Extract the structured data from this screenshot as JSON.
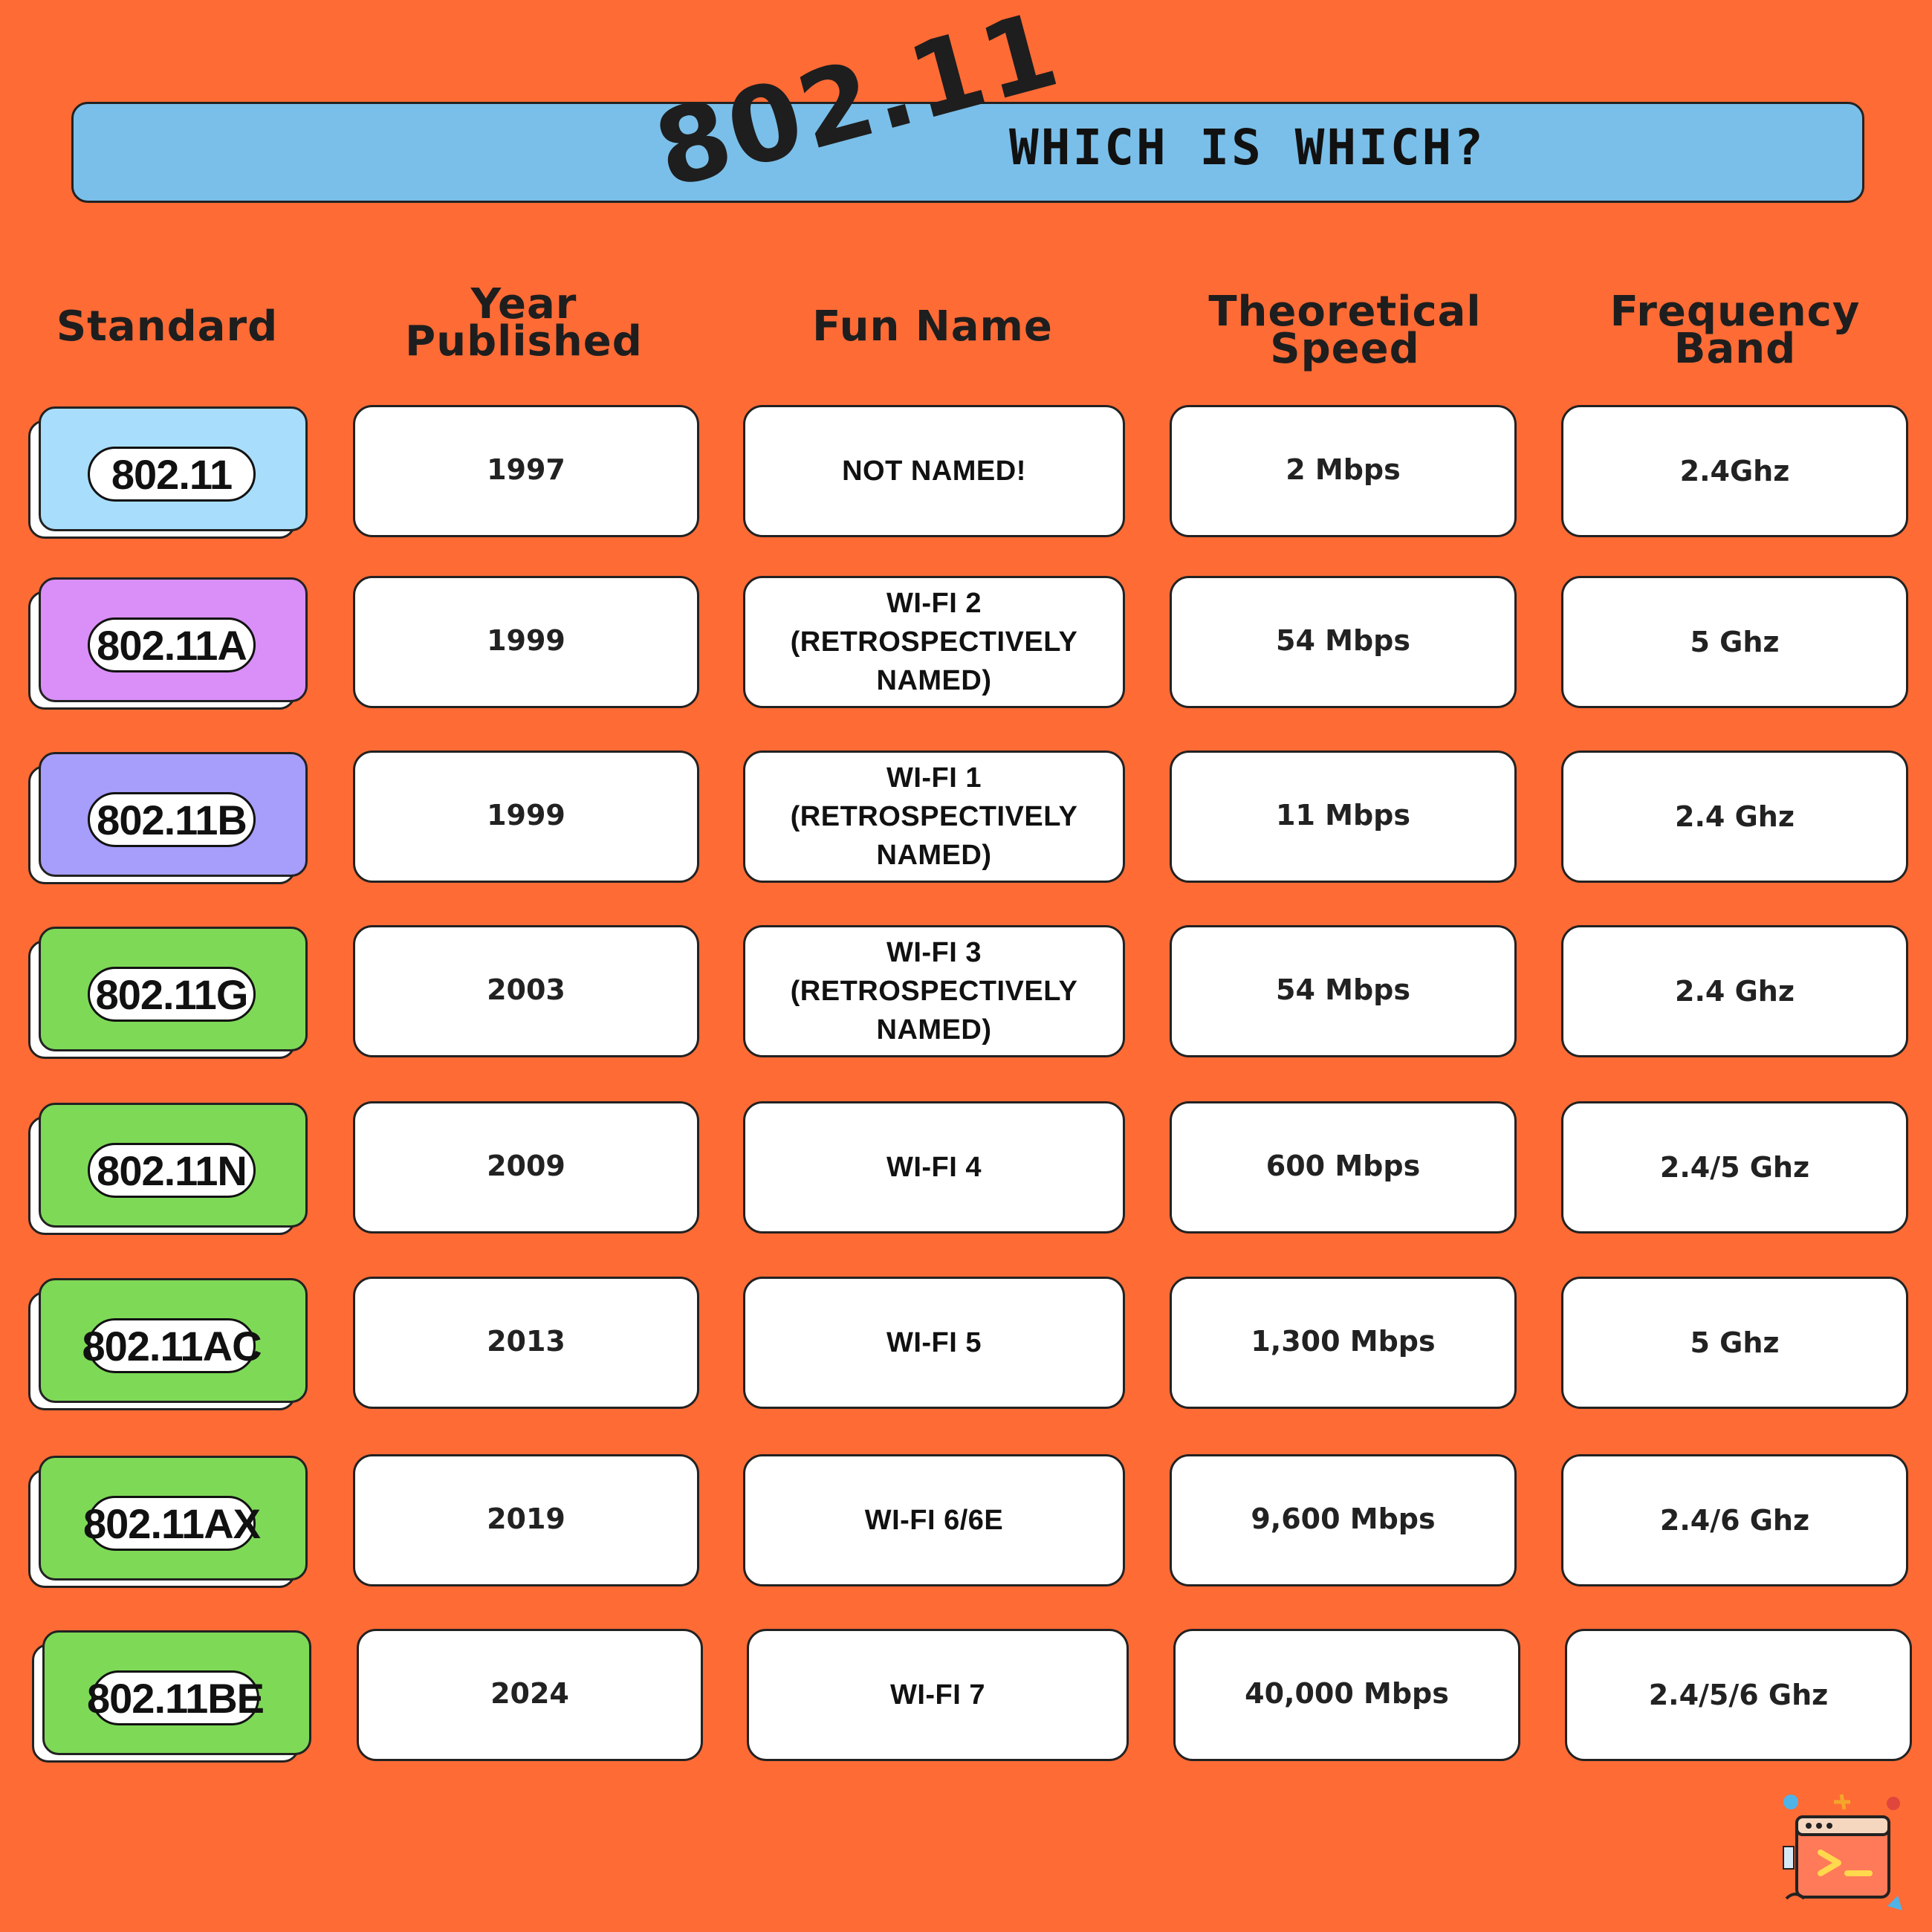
{
  "banner": {
    "big": "802.11",
    "title": "WHICH IS WHICH?"
  },
  "headers": {
    "standard": "Standard",
    "year": "Year\nPublished",
    "fun": "Fun Name",
    "speed": "Theoretical\nSpeed",
    "freq": "Frequency\nBand"
  },
  "colors": {
    "background": "#ff6b35",
    "banner": "#7abfe9",
    "light_blue": "#a8ddfb",
    "violet": "#d98ff7",
    "periwinkle": "#a79dfb",
    "green": "#7ed957"
  },
  "rows": [
    {
      "standard": "802.11",
      "year": "1997",
      "fun": "NOT NAMED!",
      "speed": "2 Mbps",
      "freq": "2.4Ghz",
      "color": "#a8ddfb"
    },
    {
      "standard": "802.11A",
      "year": "1999",
      "fun": "WI-FI 2\n(RETROSPECTIVELY NAMED)",
      "speed": "54 Mbps",
      "freq": "5 Ghz",
      "color": "#d98ff7"
    },
    {
      "standard": "802.11B",
      "year": "1999",
      "fun": "WI-FI 1\n(RETROSPECTIVELY NAMED)",
      "speed": "11 Mbps",
      "freq": "2.4 Ghz",
      "color": "#a79dfb"
    },
    {
      "standard": "802.11G",
      "year": "2003",
      "fun": "WI-FI 3\n(RETROSPECTIVELY NAMED)",
      "speed": "54 Mbps",
      "freq": "2.4 Ghz",
      "color": "#7ed957"
    },
    {
      "standard": "802.11N",
      "year": "2009",
      "fun": "WI-FI 4",
      "speed": "600 Mbps",
      "freq": "2.4/5 Ghz",
      "color": "#7ed957"
    },
    {
      "standard": "802.11AC",
      "year": "2013",
      "fun": "WI-FI 5",
      "speed": "1,300 Mbps",
      "freq": "5 Ghz",
      "color": "#7ed957"
    },
    {
      "standard": "802.11AX",
      "year": "2019",
      "fun": "WI-FI 6/6E",
      "speed": "9,600 Mbps",
      "freq": "2.4/6 Ghz",
      "color": "#7ed957"
    },
    {
      "standard": "802.11BE",
      "year": "2024",
      "fun": "WI-FI 7",
      "speed": "40,000 Mbps",
      "freq": "2.4/5/6 Ghz",
      "color": "#7ed957"
    }
  ],
  "logo": {
    "icon": "terminal-window-icon"
  }
}
